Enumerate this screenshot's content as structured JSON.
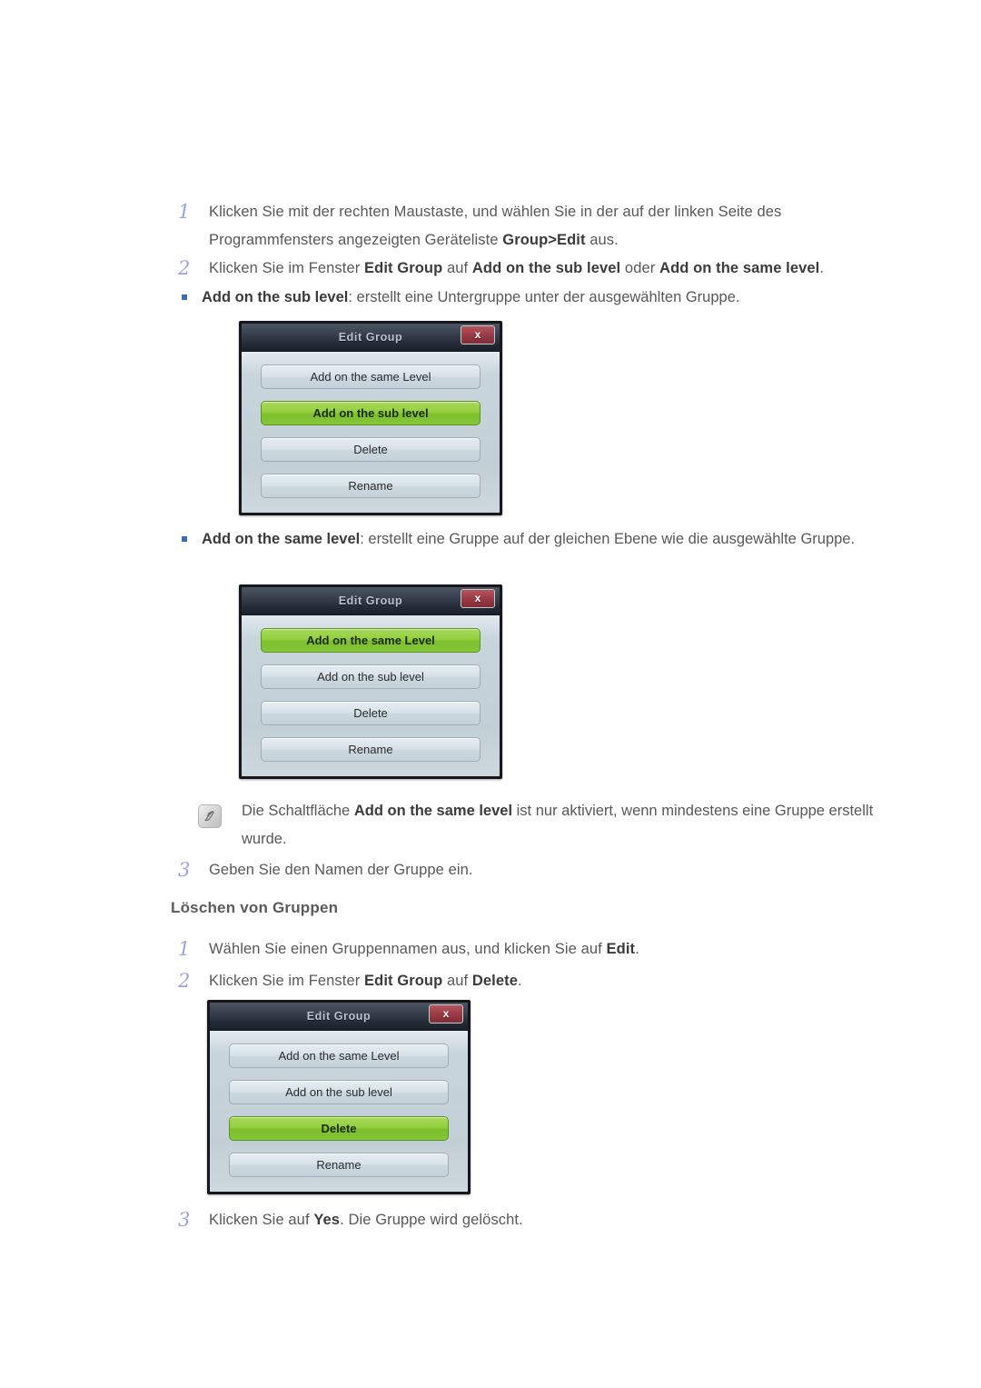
{
  "page": {
    "steps_top": [
      {
        "num": "1",
        "html": "Klicken Sie mit der rechten Maustaste, und wählen Sie in der auf der linken Seite des Programmfensters angezeigten Geräteliste <b>Group&gt;Edit</b> aus."
      },
      {
        "num": "2",
        "html": "Klicken Sie im Fenster <b>Edit Group</b> auf <b>Add on the sub level</b> oder <b>Add on the same level</b>."
      }
    ],
    "bullet_sub": {
      "html": "<b>Add on the sub level</b>: erstellt eine Untergruppe unter der ausgewählten Gruppe."
    },
    "bullet_same": {
      "html": "<b>Add on the same level</b>: erstellt eine Gruppe auf der gleichen Ebene wie die ausgewählte Gruppe."
    },
    "note": {
      "icon": "note-pencil-icon",
      "html": "Die Schaltfläche <b>Add on the same level</b> ist nur aktiviert, wenn mindestens eine Gruppe erstellt wurde."
    },
    "step3_top": {
      "num": "3",
      "html": "Geben Sie den Namen der Gruppe ein."
    },
    "section_heading": "Löschen von Gruppen",
    "steps_delete": [
      {
        "num": "1",
        "html": "Wählen Sie einen Gruppennamen aus, und klicken Sie auf <b>Edit</b>."
      },
      {
        "num": "2",
        "html": "Klicken Sie im Fenster <b>Edit Group</b> auf <b>Delete</b>."
      }
    ],
    "step3_bottom": {
      "num": "3",
      "html": "Klicken Sie auf <b>Yes</b>. Die Gruppe wird gelöscht."
    }
  },
  "dialogs": [
    {
      "title": "Edit Group",
      "close_label": "x",
      "buttons": [
        {
          "label": "Add on the same Level",
          "highlighted": false
        },
        {
          "label": "Add on the sub level",
          "highlighted": true
        },
        {
          "label": "Delete",
          "highlighted": false
        },
        {
          "label": "Rename",
          "highlighted": false
        }
      ]
    },
    {
      "title": "Edit Group",
      "close_label": "x",
      "buttons": [
        {
          "label": "Add on the same Level",
          "highlighted": true
        },
        {
          "label": "Add on the sub level",
          "highlighted": false
        },
        {
          "label": "Delete",
          "highlighted": false
        },
        {
          "label": "Rename",
          "highlighted": false
        }
      ]
    },
    {
      "title": "Edit Group",
      "close_label": "x",
      "buttons": [
        {
          "label": "Add on the same Level",
          "highlighted": false
        },
        {
          "label": "Add on the sub level",
          "highlighted": false
        },
        {
          "label": "Delete",
          "highlighted": true
        },
        {
          "label": "Rename",
          "highlighted": false
        }
      ]
    }
  ],
  "colors": {
    "step_number": "#9aa3e2",
    "bullet": "#3d6fb0",
    "body_text": "#58585a",
    "highlight_green": "#86c63a",
    "close_red": "#9b3b45",
    "titlebar_dark": "#232a36"
  }
}
